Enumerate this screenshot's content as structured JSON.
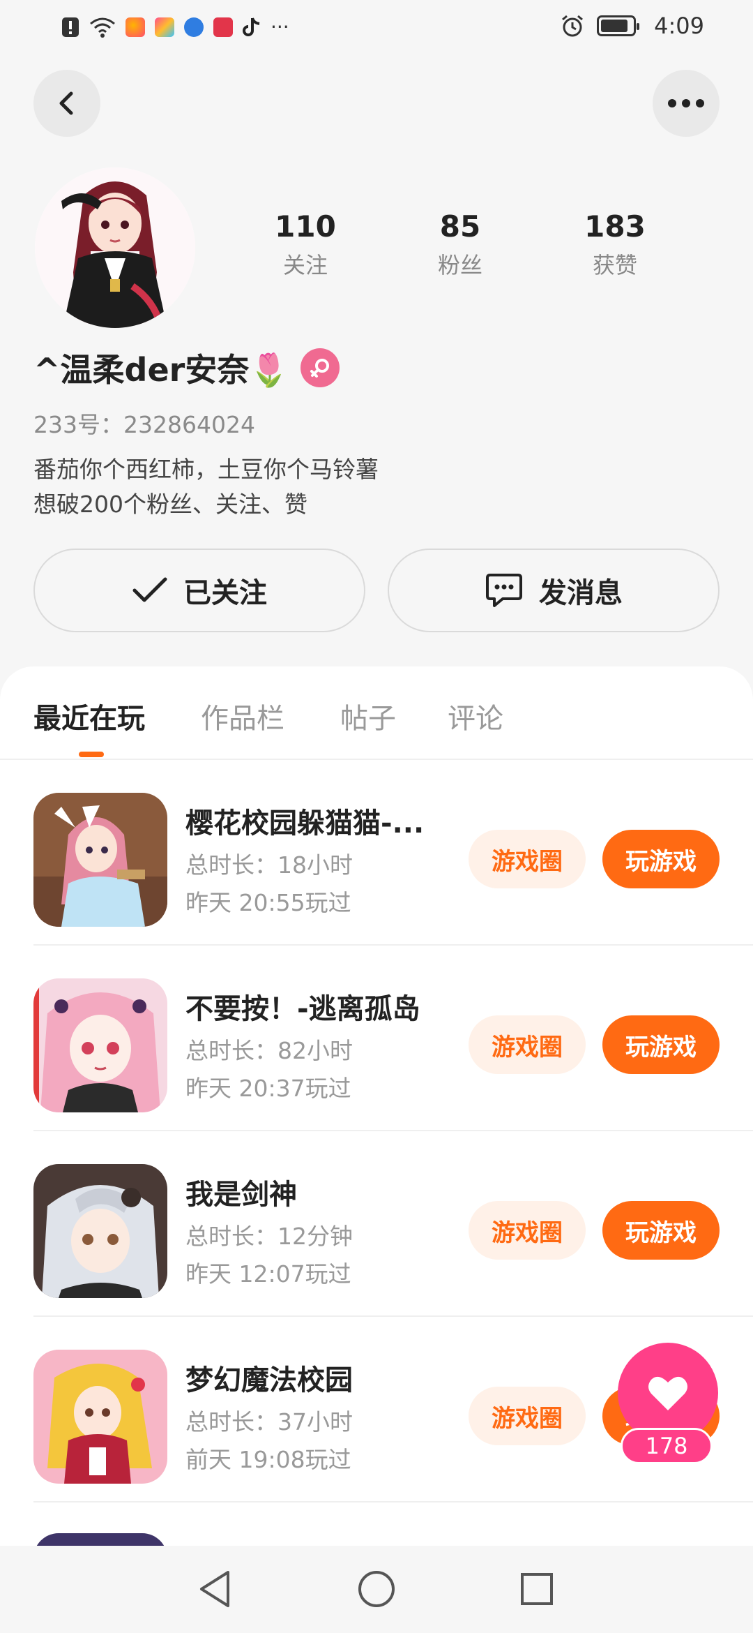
{
  "status_bar": {
    "time": "4:09",
    "more_dots": "···"
  },
  "header": {
    "back_icon": "chevron-left-icon",
    "more_icon": "more-horizontal-icon"
  },
  "profile": {
    "username": "^温柔der安奈🌷",
    "gender": "female",
    "uid": "233号：232864024",
    "bio_line1": "番茄你个西红柿，土豆你个马铃薯",
    "bio_line2": "想破200个粉丝、关注、赞",
    "stats": [
      {
        "num": "110",
        "label": "关注"
      },
      {
        "num": "85",
        "label": "粉丝"
      },
      {
        "num": "183",
        "label": "获赞"
      }
    ],
    "follow_label": "已关注",
    "message_label": "发消息"
  },
  "tabs": [
    {
      "label": "最近在玩",
      "active": true
    },
    {
      "label": "作品栏",
      "active": false
    },
    {
      "label": "帖子",
      "active": false
    },
    {
      "label": "评论",
      "active": false
    }
  ],
  "games": [
    {
      "name": "樱花校园躲猫猫-...",
      "duration": "总时长：18小时",
      "last_played": "昨天 20:55玩过",
      "circle_label": "游戏圈",
      "play_label": "玩游戏"
    },
    {
      "name": "不要按！-逃离孤岛",
      "duration": "总时长：82小时",
      "last_played": "昨天 20:37玩过",
      "circle_label": "游戏圈",
      "play_label": "玩游戏"
    },
    {
      "name": "我是剑神",
      "duration": "总时长：12分钟",
      "last_played": "昨天 12:07玩过",
      "circle_label": "游戏圈",
      "play_label": "玩游戏"
    },
    {
      "name": "梦幻魔法校园",
      "duration": "总时长：37小时",
      "last_played": "前天 19:08玩过",
      "circle_label": "游戏圈",
      "play_label": "玩游戏"
    }
  ],
  "like_fab": {
    "count": "178"
  },
  "colors": {
    "accent": "#ff6a13",
    "accent_light": "#fff1e8",
    "like_pink": "#ff3f88",
    "gender_pink": "#f06a91"
  }
}
